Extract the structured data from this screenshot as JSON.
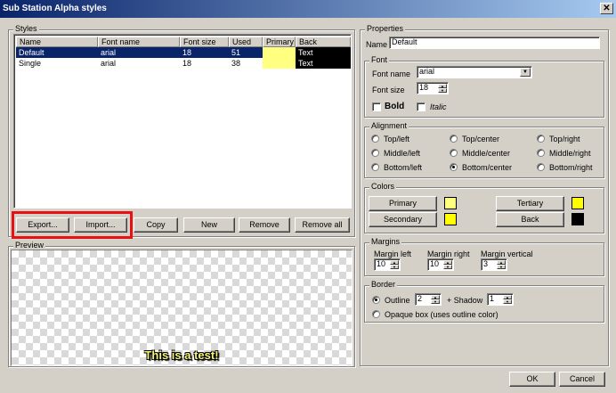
{
  "window": {
    "title": "Sub Station Alpha styles",
    "close_glyph": "✕"
  },
  "styles": {
    "group_label": "Styles",
    "columns": [
      "Name",
      "Font name",
      "Font size",
      "Used",
      "Primary",
      "Back"
    ],
    "rows": [
      {
        "name": "Default",
        "font": "arial",
        "size": "18",
        "used": "51",
        "primary_color": "#ffff80",
        "back_text": "Text",
        "selected": true
      },
      {
        "name": "Single",
        "font": "arial",
        "size": "18",
        "used": "38",
        "primary_color": "#ffff80",
        "back_text": "Text",
        "selected": false
      }
    ],
    "buttons": {
      "export": "Export...",
      "import": "Import...",
      "copy": "Copy",
      "new": "New",
      "remove": "Remove",
      "remove_all": "Remove all"
    }
  },
  "preview": {
    "group_label": "Preview",
    "text": "This is a test!"
  },
  "properties": {
    "group_label": "Properties",
    "name_label": "Name",
    "name_value": "Default"
  },
  "font": {
    "group_label": "Font",
    "name_label": "Font name",
    "name_value": "arial",
    "size_label": "Font size",
    "size_value": "18",
    "bold_label": "Bold",
    "italic_label": "Italic"
  },
  "alignment": {
    "group_label": "Alignment",
    "options": [
      "Top/left",
      "Top/center",
      "Top/right",
      "Middle/left",
      "Middle/center",
      "Middle/right",
      "Bottom/left",
      "Bottom/center",
      "Bottom/right"
    ],
    "selected": "Bottom/center"
  },
  "colors": {
    "group_label": "Colors",
    "primary": {
      "label": "Primary",
      "color": "#ffff80"
    },
    "secondary": {
      "label": "Secondary",
      "color": "#ffff00"
    },
    "tertiary": {
      "label": "Tertiary",
      "color": "#ffff00"
    },
    "back": {
      "label": "Back",
      "color": "#000000"
    }
  },
  "margins": {
    "group_label": "Margins",
    "left_label": "Margin left",
    "left_value": "10",
    "right_label": "Margin right",
    "right_value": "10",
    "vertical_label": "Margin vertical",
    "vertical_value": "3"
  },
  "border": {
    "group_label": "Border",
    "outline_label": "Outline",
    "outline_value": "2",
    "shadow_label": "+ Shadow",
    "shadow_value": "1",
    "opaque_label": "Opaque box (uses outline color)"
  },
  "dialog": {
    "ok": "OK",
    "cancel": "Cancel"
  },
  "highlight_color": "#e81010"
}
